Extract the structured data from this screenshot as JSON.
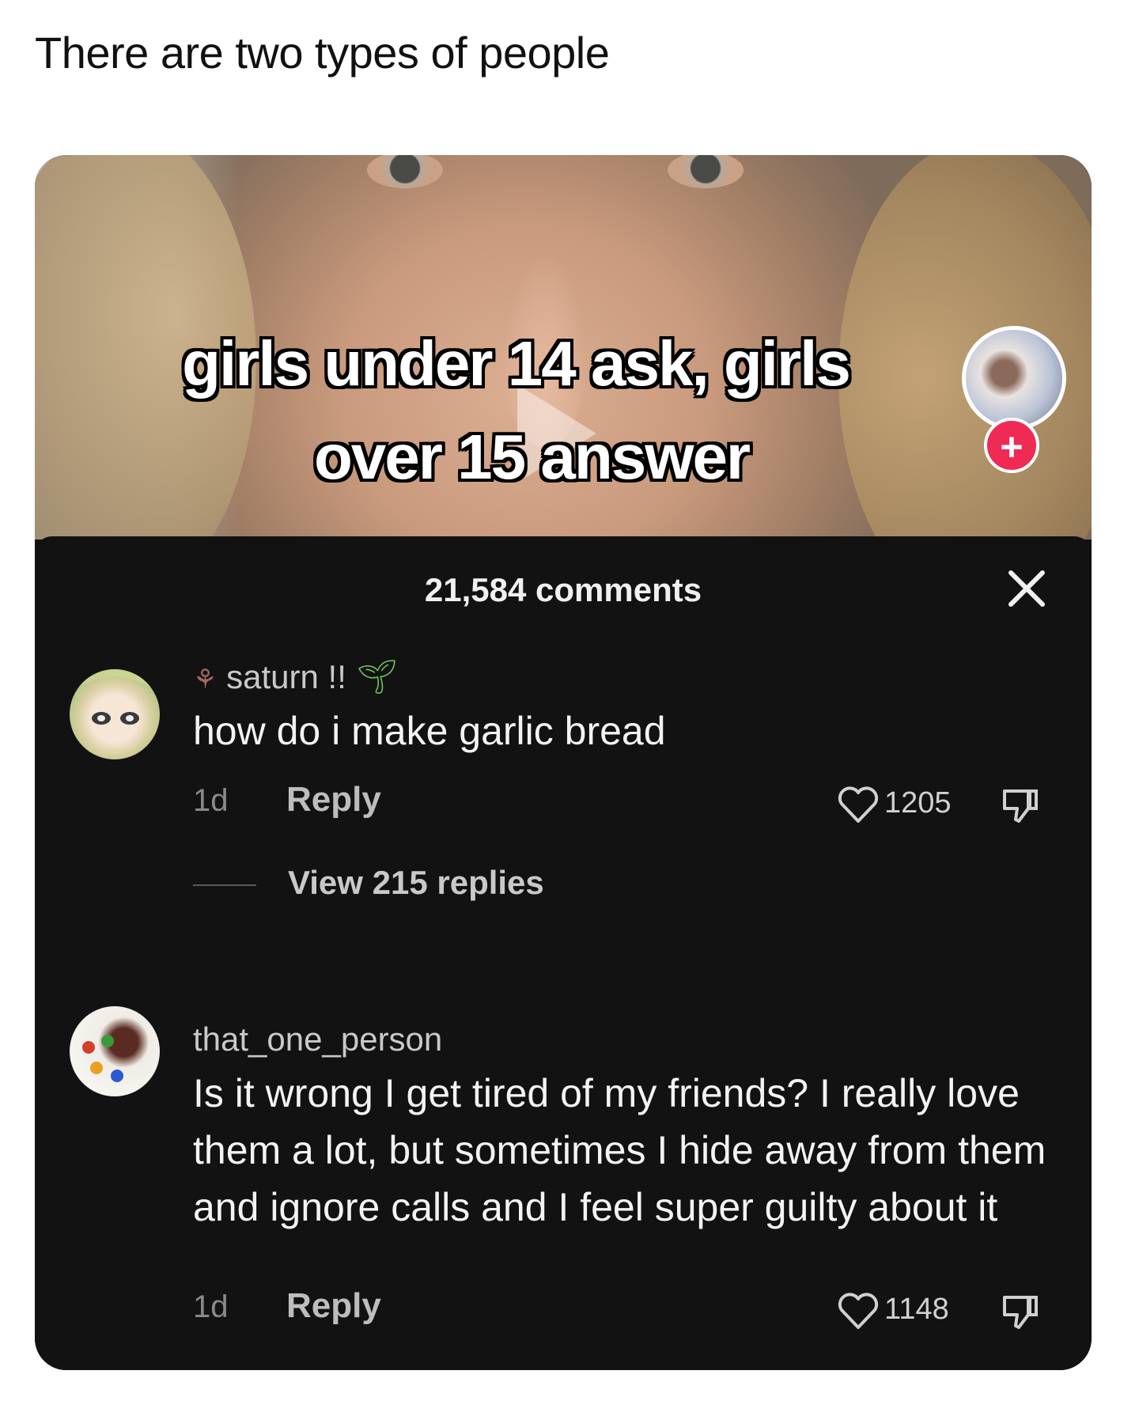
{
  "post": {
    "title": "There are two types of people"
  },
  "video": {
    "overlay_line1": "girls under 14 ask, girls",
    "overlay_line2": "over 15 answer",
    "follow_symbol": "+"
  },
  "comments_panel": {
    "count_label": "21,584 comments",
    "close_icon": "close-icon",
    "comments": [
      {
        "username": "saturn !!",
        "text": "how do i make garlic bread",
        "time": "1d",
        "reply_label": "Reply",
        "likes": "1205",
        "view_replies": "View 215 replies"
      },
      {
        "username": "that_one_person",
        "text": "Is it wrong I get tired of my friends? I really love them a lot, but sometimes I hide away from them and ignore calls and I feel super guilty about it",
        "time": "1d",
        "reply_label": "Reply",
        "likes": "1148"
      }
    ]
  },
  "colors": {
    "accent": "#ef2a55",
    "panel_bg": "#121212",
    "text": "#f3f3f3",
    "muted": "#8a8a8a"
  }
}
